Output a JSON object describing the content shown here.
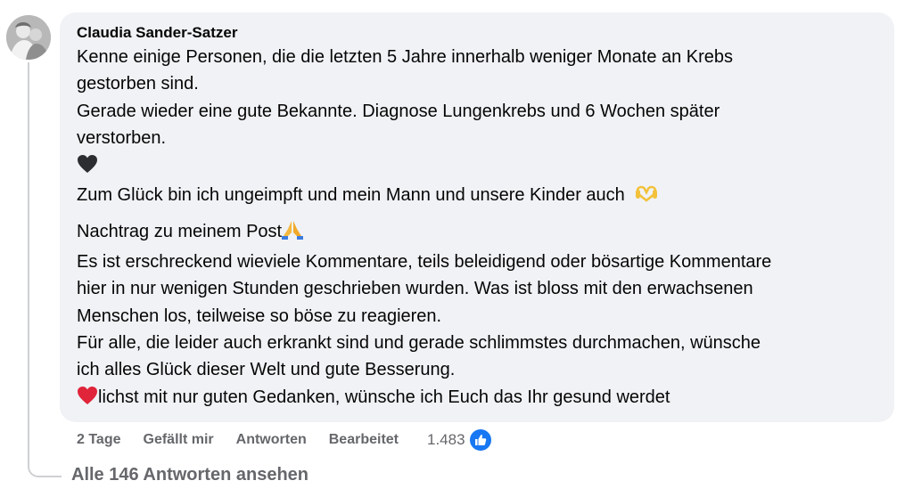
{
  "comment": {
    "author": "Claudia Sander-Satzer",
    "lines": [
      "Kenne einige Personen, die die letzten 5 Jahre innerhalb weniger Monate an Krebs",
      "gestorben sind.",
      "Gerade wieder eine gute Bekannte. Diagnose Lungenkrebs und 6 Wochen später",
      "verstorben.",
      "Zum Glück bin ich ungeimpft und mein Mann und unsere Kinder auch",
      "Nachtrag zu meinem Post",
      "Es ist erschreckend wieviele Kommentare, teils beleidigend oder bösartige Kommentare",
      "hier in nur wenigen Stunden geschrieben wurden. Was ist bloss mit den erwachsenen",
      "Menschen los, teilweise so böse zu reagieren.",
      "Für alle, die leider auch erkrankt sind und gerade schlimmstes durchmachen, wünsche",
      "ich alles Glück dieser Welt und gute Besserung.",
      "lichst mit nur guten Gedanken, wünsche ich Euch das Ihr gesund werdet"
    ]
  },
  "actions": {
    "time": "2 Tage",
    "like": "Gefällt mir",
    "reply": "Antworten",
    "edited": "Bearbeitet",
    "reaction_count": "1.483"
  },
  "replies": {
    "view_all": "Alle 146 Antworten ansehen"
  },
  "colors": {
    "bubble": "#f0f2f5",
    "secondary_text": "#65676b",
    "like_blue": "#1877f2"
  }
}
